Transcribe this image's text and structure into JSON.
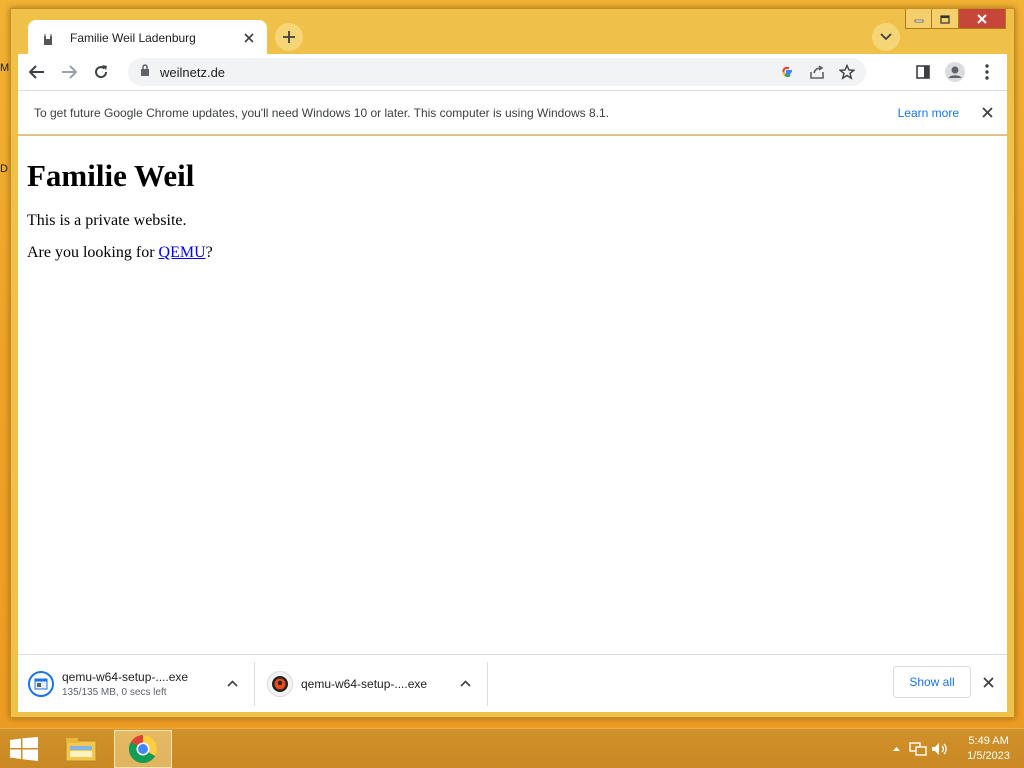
{
  "desktop": {
    "fragments": [
      "M",
      "D"
    ]
  },
  "window": {
    "tab": {
      "title": "Familie Weil Ladenburg"
    },
    "controls": {
      "minimize": "minimize",
      "maximize": "maximize",
      "close": "close"
    }
  },
  "toolbar": {
    "url": "weilnetz.de"
  },
  "infobar": {
    "message": "To get future Google Chrome updates, you'll need Windows 10 or later. This computer is using Windows 8.1.",
    "link": "Learn more"
  },
  "page": {
    "heading": "Familie Weil",
    "line1": "This is a private website.",
    "line2_prefix": "Are you looking for ",
    "link": "QEMU",
    "line2_suffix": "?"
  },
  "downloads": {
    "items": [
      {
        "name": "qemu-w64-setup-....exe",
        "status": "135/135 MB, 0 secs left",
        "icon": "installer-icon"
      },
      {
        "name": "qemu-w64-setup-....exe",
        "status": "",
        "icon": "qemu-logo-icon"
      }
    ],
    "show_all": "Show all"
  },
  "taskbar": {
    "apps": [
      "file-explorer",
      "google-chrome"
    ],
    "time": "5:49 AM",
    "date": "1/5/2023"
  },
  "colors": {
    "desktop": "#ef9f25",
    "window_frame": "#f0c149",
    "link": "#1a73e8",
    "close_button": "#c7463a"
  }
}
